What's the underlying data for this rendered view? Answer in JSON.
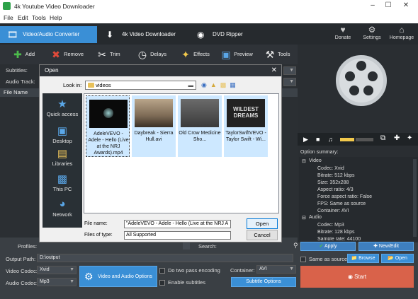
{
  "window": {
    "title": "4k Youtube Video Downloader"
  },
  "menu": [
    "File",
    "Edit",
    "Tools",
    "Help"
  ],
  "tabs": [
    {
      "label": "Video/Audio Converter",
      "icon": "film-icon"
    },
    {
      "label": "4k Video Downloader",
      "icon": "download-icon"
    },
    {
      "label": "DVD Ripper",
      "icon": "disc-icon"
    }
  ],
  "right_buttons": [
    {
      "label": "Donate",
      "icon": "heart-icon"
    },
    {
      "label": "Settings",
      "icon": "gear-icon"
    },
    {
      "label": "Homepage",
      "icon": "home-icon"
    }
  ],
  "toolbar": [
    {
      "label": "Add",
      "icon": "plus-icon"
    },
    {
      "label": "Remove",
      "icon": "remove-icon"
    },
    {
      "label": "Trim",
      "icon": "scissors-icon"
    },
    {
      "label": "Delays",
      "icon": "clock-icon"
    },
    {
      "label": "Effects",
      "icon": "wand-icon"
    },
    {
      "label": "Preview",
      "icon": "preview-icon"
    },
    {
      "label": "Tools",
      "icon": "tools-icon"
    }
  ],
  "left": {
    "subtitles_label": "Subtitles:",
    "audio_track_label": "Audio Track:",
    "file_name_header": "File Name",
    "profiles_label": "Profiles:",
    "search_label": "Search:",
    "output_path_label": "Output Path:",
    "output_path_value": "D:\\output",
    "video_codec_label": "Video Codec:",
    "video_codec_value": "Xvid",
    "audio_codec_label": "Audio Codec:",
    "audio_codec_value": "Mp3",
    "video_audio_options": "Video and Audio Options",
    "two_pass": "Do two pass encoding",
    "enable_subtitles": "Enable subtitles",
    "container_label": "Container:",
    "container_value": "AVI",
    "subtitle_options": "Subtitle Options"
  },
  "dialog": {
    "title": "Open",
    "look_in_label": "Look in:",
    "look_in_value": "videos",
    "places": [
      {
        "label": "Quick access",
        "icon": "star-icon"
      },
      {
        "label": "Desktop",
        "icon": "desktop-icon"
      },
      {
        "label": "Libraries",
        "icon": "libraries-icon"
      },
      {
        "label": "This PC",
        "icon": "pc-icon"
      },
      {
        "label": "Network",
        "icon": "network-icon"
      }
    ],
    "files": [
      {
        "caption": "AdeleVEVO - Adele - Hello (Live at the NRJ Awards).mp4"
      },
      {
        "caption": "Daybreak - Sierra Hull.avi"
      },
      {
        "caption": "Old Crow Medicine Sho..."
      },
      {
        "caption": "TaylorSwiftVEVO - Taylor Swift - Wi..."
      }
    ],
    "thumb_text": "WILDEST DREAMS",
    "file_name_label": "File name:",
    "file_name_value": "\"AdeleVEVO - Adele - Hello (Live at the NRJ A",
    "files_of_type_label": "Files of type:",
    "files_of_type_value": "All Supported",
    "open_button": "Open",
    "cancel_button": "Cancel"
  },
  "right": {
    "option_summary_label": "Option summary:",
    "video_header": "Video",
    "video_items": [
      "Codec: Xvid",
      "Bitrate: 512 kbps",
      "Size: 352x288",
      "Aspect ratio: 4/3",
      "Force aspect ratio: False",
      "FPS: Same as source",
      "Container: AVI"
    ],
    "audio_header": "Audio",
    "audio_items": [
      "Codec: Mp3",
      "Bitrate: 128 kbps",
      "Sample rate: 44100"
    ],
    "apply_button": "Apply",
    "new_edit_button": "New/Edit",
    "same_as_source": "Same as source",
    "browse_button": "Browse",
    "open_button": "Open",
    "start_button": "Start"
  },
  "colors": {
    "accent": "#3a8fd6",
    "start": "#d9624a",
    "dialog_bg": "#f0f0f0",
    "selected_file": "#cde8ff"
  }
}
